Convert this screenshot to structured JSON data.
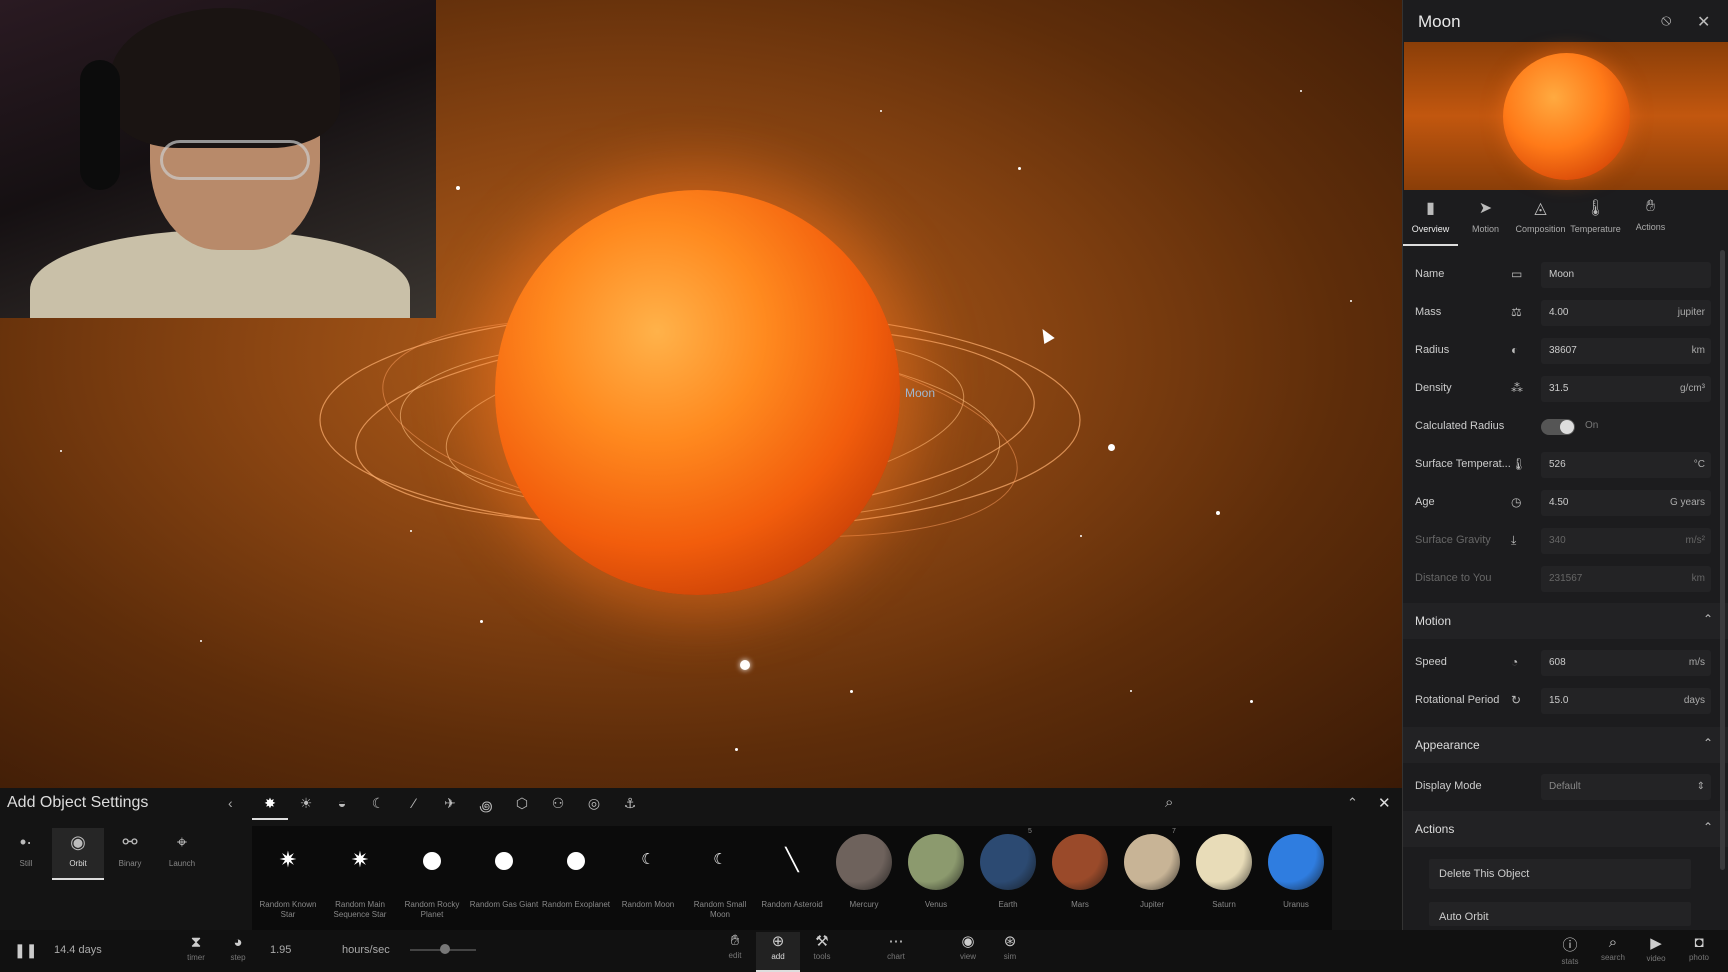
{
  "viewport": {
    "moon_label": "Moon"
  },
  "panel": {
    "title": "Moon",
    "tabs": [
      {
        "label": "Overview",
        "icon": "bookmark-icon"
      },
      {
        "label": "Motion",
        "icon": "motion-icon"
      },
      {
        "label": "Composition",
        "icon": "composition-icon"
      },
      {
        "label": "Temperature",
        "icon": "thermometer-icon"
      },
      {
        "label": "Actions",
        "icon": "actions-icon"
      }
    ],
    "fields": {
      "name": {
        "label": "Name",
        "value": "Moon",
        "unit": ""
      },
      "mass": {
        "label": "Mass",
        "value": "4.00",
        "unit": "jupiter"
      },
      "radius": {
        "label": "Radius",
        "value": "38607",
        "unit": "km"
      },
      "density": {
        "label": "Density",
        "value": "31.5",
        "unit": "g/cm³"
      },
      "calc_radius": {
        "label": "Calculated Radius",
        "state": "On"
      },
      "surface_temp": {
        "label": "Surface Temperat...",
        "value": "526",
        "unit": "°C"
      },
      "age": {
        "label": "Age",
        "value": "4.50",
        "unit": "G years"
      },
      "surface_gravity": {
        "label": "Surface Gravity",
        "value": "340",
        "unit": "m/s²"
      },
      "distance": {
        "label": "Distance to You",
        "value": "231567",
        "unit": "km"
      }
    },
    "motion": {
      "title": "Motion",
      "speed": {
        "label": "Speed",
        "value": "608",
        "unit": "m/s"
      },
      "rotational_period": {
        "label": "Rotational Period",
        "value": "15.0",
        "unit": "days"
      }
    },
    "appearance": {
      "title": "Appearance",
      "display_mode": {
        "label": "Display Mode",
        "value": "Default"
      }
    },
    "actions": {
      "title": "Actions",
      "delete": "Delete This Object",
      "auto_orbit": "Auto Orbit"
    }
  },
  "addbar": {
    "title": "Add Object Settings",
    "modes": [
      {
        "label": "Still",
        "icon": "still-icon"
      },
      {
        "label": "Orbit",
        "icon": "orbit-icon"
      },
      {
        "label": "Binary",
        "icon": "binary-icon"
      },
      {
        "label": "Launch",
        "icon": "launch-icon"
      }
    ],
    "objects": [
      {
        "label": "Random Known Star",
        "kind": "star"
      },
      {
        "label": "Random Main Sequence Star",
        "kind": "star"
      },
      {
        "label": "Random Rocky Planet",
        "kind": "dot"
      },
      {
        "label": "Random Gas Giant",
        "kind": "dot"
      },
      {
        "label": "Random Exoplanet",
        "kind": "dot"
      },
      {
        "label": "Random Moon",
        "kind": "moon"
      },
      {
        "label": "Random Small Moon",
        "kind": "moon"
      },
      {
        "label": "Random Asteroid",
        "kind": "asteroid"
      },
      {
        "label": "Mercury",
        "kind": "planet",
        "color": "#6e625c"
      },
      {
        "label": "Venus",
        "kind": "planet",
        "color": "#8c9a6e"
      },
      {
        "label": "Earth",
        "kind": "planet",
        "color": "#2c4a72",
        "num": "5"
      },
      {
        "label": "Mars",
        "kind": "planet",
        "color": "#9a4a2a"
      },
      {
        "label": "Jupiter",
        "kind": "planet",
        "color": "#c8b496",
        "num": "7"
      },
      {
        "label": "Saturn",
        "kind": "planet",
        "color": "#e8dcb8"
      },
      {
        "label": "Uranus",
        "kind": "planet",
        "color": "#2f7de0"
      }
    ]
  },
  "statusbar": {
    "time_elapsed": "14.4 days",
    "timer_label": "timer",
    "step_label": "step",
    "step_value": "1.95",
    "rate_unit": "hours/sec",
    "buttons": [
      {
        "label": "edit",
        "icon": "hand-icon"
      },
      {
        "label": "add",
        "icon": "add-icon"
      },
      {
        "label": "tools",
        "icon": "tools-icon"
      },
      {
        "label": "chart",
        "icon": "chart-icon"
      },
      {
        "label": "view",
        "icon": "eye-icon"
      },
      {
        "label": "sim",
        "icon": "sim-icon"
      }
    ],
    "right_buttons": [
      {
        "label": "stats",
        "icon": "info-icon"
      },
      {
        "label": "search",
        "icon": "search-icon"
      },
      {
        "label": "video",
        "icon": "video-icon"
      },
      {
        "label": "photo",
        "icon": "camera-icon"
      }
    ]
  }
}
